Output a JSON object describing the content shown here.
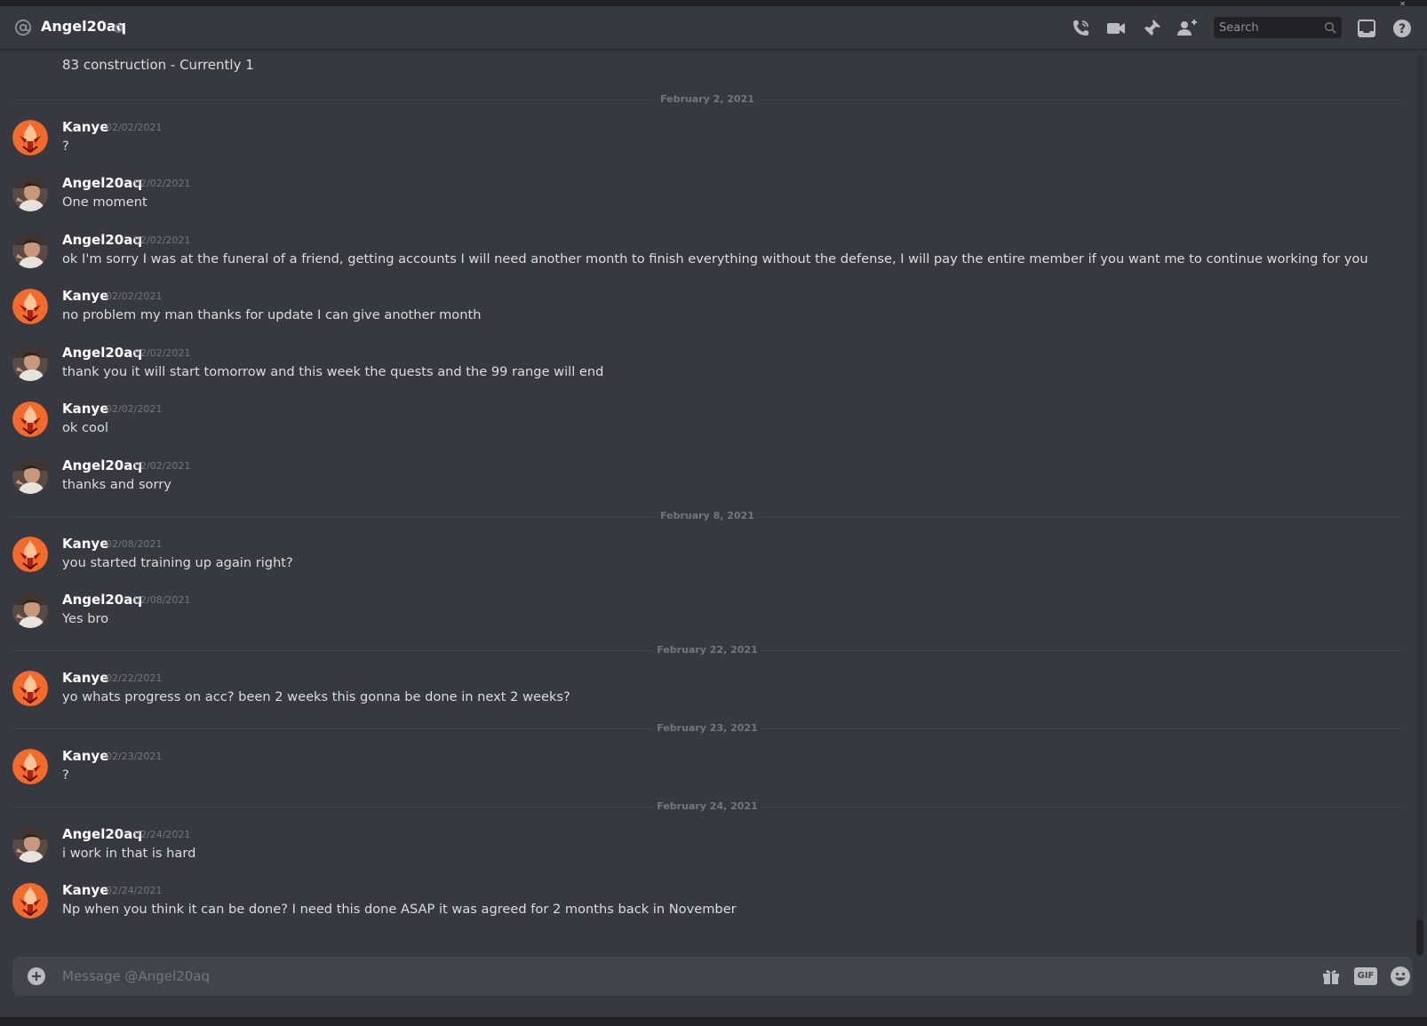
{
  "header": {
    "channel_name": "Angel20aq",
    "search_placeholder": "Search"
  },
  "top_fragment": "83 construction - Currently 1",
  "dividers": [
    "February 2, 2021",
    "February 8, 2021",
    "February 22, 2021",
    "February 23, 2021",
    "February 24, 2021"
  ],
  "messages": [
    {
      "author": "Kanye",
      "time": "02/02/2021",
      "text": "?"
    },
    {
      "author": "Angel20aq",
      "time": "02/02/2021",
      "text": "One moment"
    },
    {
      "author": "Angel20aq",
      "time": "02/02/2021",
      "text": "ok I'm sorry I was at the funeral of a friend, getting accounts I will need another month to finish everything without the defense, I will pay the entire member if you want me to continue working for you"
    },
    {
      "author": "Kanye",
      "time": "02/02/2021",
      "text": "no problem my man thanks for update I can give another month"
    },
    {
      "author": "Angel20aq",
      "time": "02/02/2021",
      "text": "thank you it will start tomorrow and this week the quests and the 99 range will end"
    },
    {
      "author": "Kanye",
      "time": "02/02/2021",
      "text": "ok cool"
    },
    {
      "author": "Angel20aq",
      "time": "02/02/2021",
      "text": "thanks and sorry"
    },
    {
      "author": "Kanye",
      "time": "02/08/2021",
      "text": "you started training up again right?"
    },
    {
      "author": "Angel20aq",
      "time": "02/08/2021",
      "text": "Yes bro"
    },
    {
      "author": "Kanye",
      "time": "02/22/2021",
      "text": "yo whats progress on acc? been 2 weeks this gonna be done in next 2 weeks?"
    },
    {
      "author": "Kanye",
      "time": "02/23/2021",
      "text": "?"
    },
    {
      "author": "Angel20aq",
      "time": "02/24/2021",
      "text": "i work in that is hard"
    },
    {
      "author": "Kanye",
      "time": "02/24/2021",
      "text": "Np when you think it can be done? I need this done ASAP it was agreed for 2 months back in November"
    }
  ],
  "composer": {
    "placeholder": "Message @Angel20aq",
    "gif_label": "GIF"
  },
  "colors": {
    "background": "#36393f",
    "accent_avatar_kanye": "#f26a2c",
    "muted_text": "#72767d"
  }
}
